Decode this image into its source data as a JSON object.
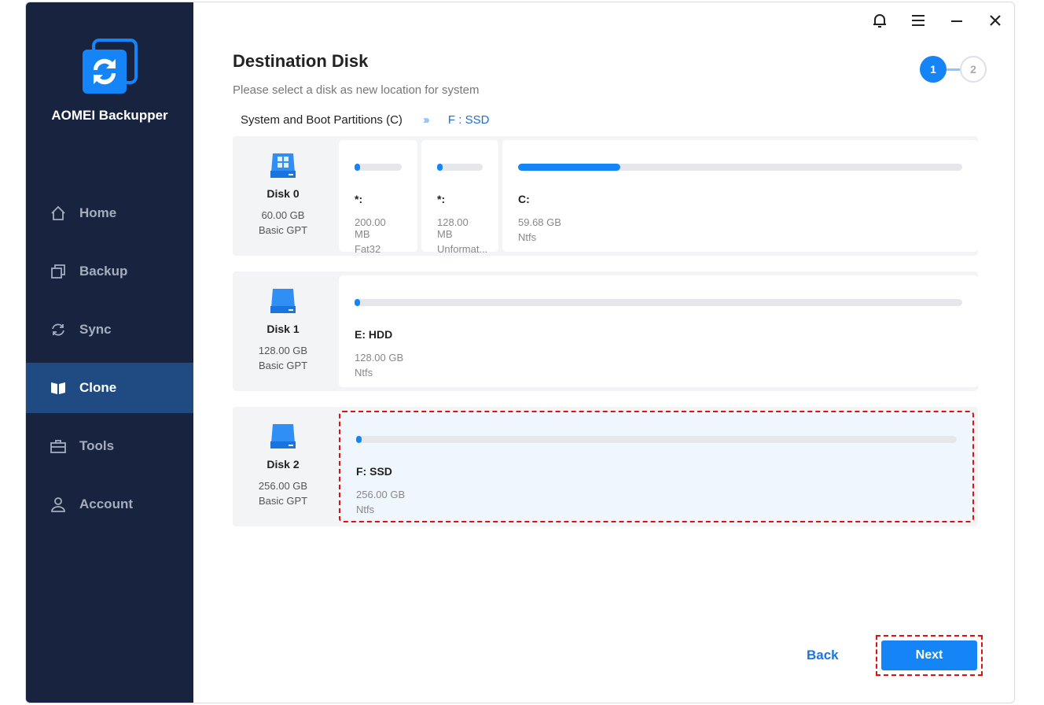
{
  "app": {
    "name": "AOMEI Backupper"
  },
  "nav": [
    {
      "label": "Home",
      "icon": "home-icon"
    },
    {
      "label": "Backup",
      "icon": "backup-icon"
    },
    {
      "label": "Sync",
      "icon": "sync-icon"
    },
    {
      "label": "Clone",
      "icon": "clone-icon",
      "active": true
    },
    {
      "label": "Tools",
      "icon": "tools-icon"
    },
    {
      "label": "Account",
      "icon": "account-icon"
    }
  ],
  "header": {
    "title": "Destination Disk",
    "subtitle": "Please select a disk as new location for system",
    "steps": [
      "1",
      "2"
    ]
  },
  "crumb": {
    "source": "System and Boot Partitions (C)",
    "dest": "F : SSD"
  },
  "disks": [
    {
      "name": "Disk 0",
      "size": "60.00 GB",
      "type": "Basic GPT",
      "partitions": [
        {
          "label": "*:",
          "size": "200.00 MB",
          "fs": "Fat32",
          "used": 0.05
        },
        {
          "label": "*:",
          "size": "128.00 MB",
          "fs": "Unformat...",
          "used": 0.03
        },
        {
          "label": "C:",
          "size": "59.68 GB",
          "fs": "Ntfs",
          "used": 0.23
        }
      ]
    },
    {
      "name": "Disk 1",
      "size": "128.00 GB",
      "type": "Basic GPT",
      "partitions": [
        {
          "label": "E: HDD",
          "size": "128.00 GB",
          "fs": "Ntfs",
          "used": 0.005
        }
      ]
    },
    {
      "name": "Disk 2",
      "size": "256.00 GB",
      "type": "Basic GPT",
      "partitions": [
        {
          "label": "F: SSD",
          "size": "256.00 GB",
          "fs": "Ntfs",
          "used": 0.005,
          "selected": true
        }
      ]
    }
  ],
  "buttons": {
    "back": "Back",
    "next": "Next"
  }
}
